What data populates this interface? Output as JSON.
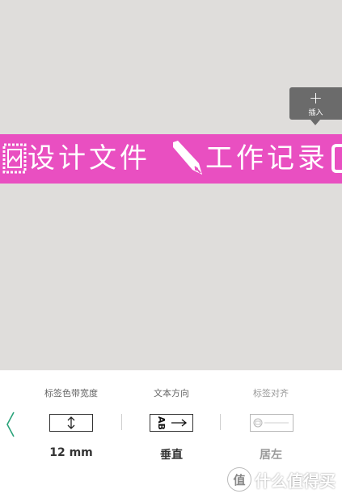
{
  "canvas": {
    "insert_button": {
      "icon": "plus-icon",
      "label": "插入"
    },
    "tape": {
      "color": "#e94fc1",
      "segment1_icon": "stamp-icon",
      "segment1_text": "设计文件",
      "segment2_icon": "fountain-pen-icon",
      "segment2_text": "工作记录"
    }
  },
  "settings": {
    "back_icon": "chevron-left-icon",
    "tape_width": {
      "title": "标签色带宽度",
      "icon": "vertical-arrows-icon",
      "value": "12 mm"
    },
    "text_direction": {
      "title": "文本方向",
      "icon": "ab-vertical-icon",
      "value": "垂直"
    },
    "label_align": {
      "title": "标签对齐",
      "icon": "align-left-preview-icon",
      "value": "居左"
    }
  },
  "watermark": {
    "badge": "值",
    "text": "什么值得买"
  }
}
